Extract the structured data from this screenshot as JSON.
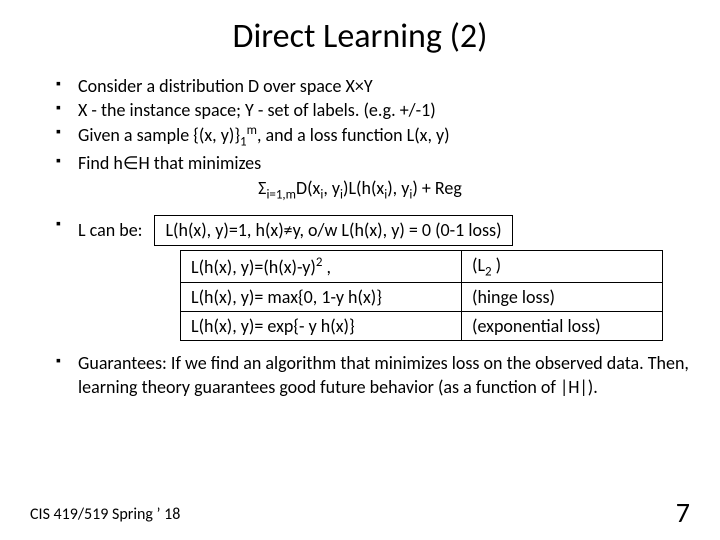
{
  "title": "Direct Learning (2)",
  "bullets": {
    "b1": "Consider a distribution D over space X×Y",
    "b2": "X - the instance space;   Y - set of labels. (e.g. +/-1)",
    "b3_pre": "Given a sample {(x, y)}",
    "b3_sub": "1",
    "b3_sup": "m",
    "b3_post": ", and a loss function L(x, y)",
    "b4": "Find  h∈H  that minimizes"
  },
  "formula": {
    "sigma": "Σ",
    "sub1": "i=1,m",
    "part1": "D(x",
    "xi1": "i",
    "comma1": ", y",
    "yi1": "i",
    "part2": ")L(h(x",
    "xi2": "i",
    "part3": "), y",
    "yi2": "i",
    "part4": ")  + Reg"
  },
  "lcanbe": "L can be:",
  "loss": {
    "r1": "L(h(x), y)=1, h(x)≠y, o/w  L(h(x), y) = 0 (0-1 loss)",
    "r2a_pre": "L(h(x), y)=(h(x)-y)",
    "r2a_sup": "2",
    "r2a_post": " ,",
    "r2b_pre": "(L",
    "r2b_sub": "2",
    "r2b_post": " )",
    "r3a": "L(h(x), y)= max{0, 1-y h(x)}",
    "r3b": "(hinge loss)",
    "r4a": "L(h(x), y)= exp{- y h(x)}",
    "r4b": "(exponential loss)"
  },
  "guarantees": "Guarantees: If we find an algorithm that minimizes loss on the observed data. Then, learning theory guarantees good future behavior (as a function of |H|).",
  "footer_left": "CIS 419/519 Spring ’ 18",
  "footer_right": "7"
}
